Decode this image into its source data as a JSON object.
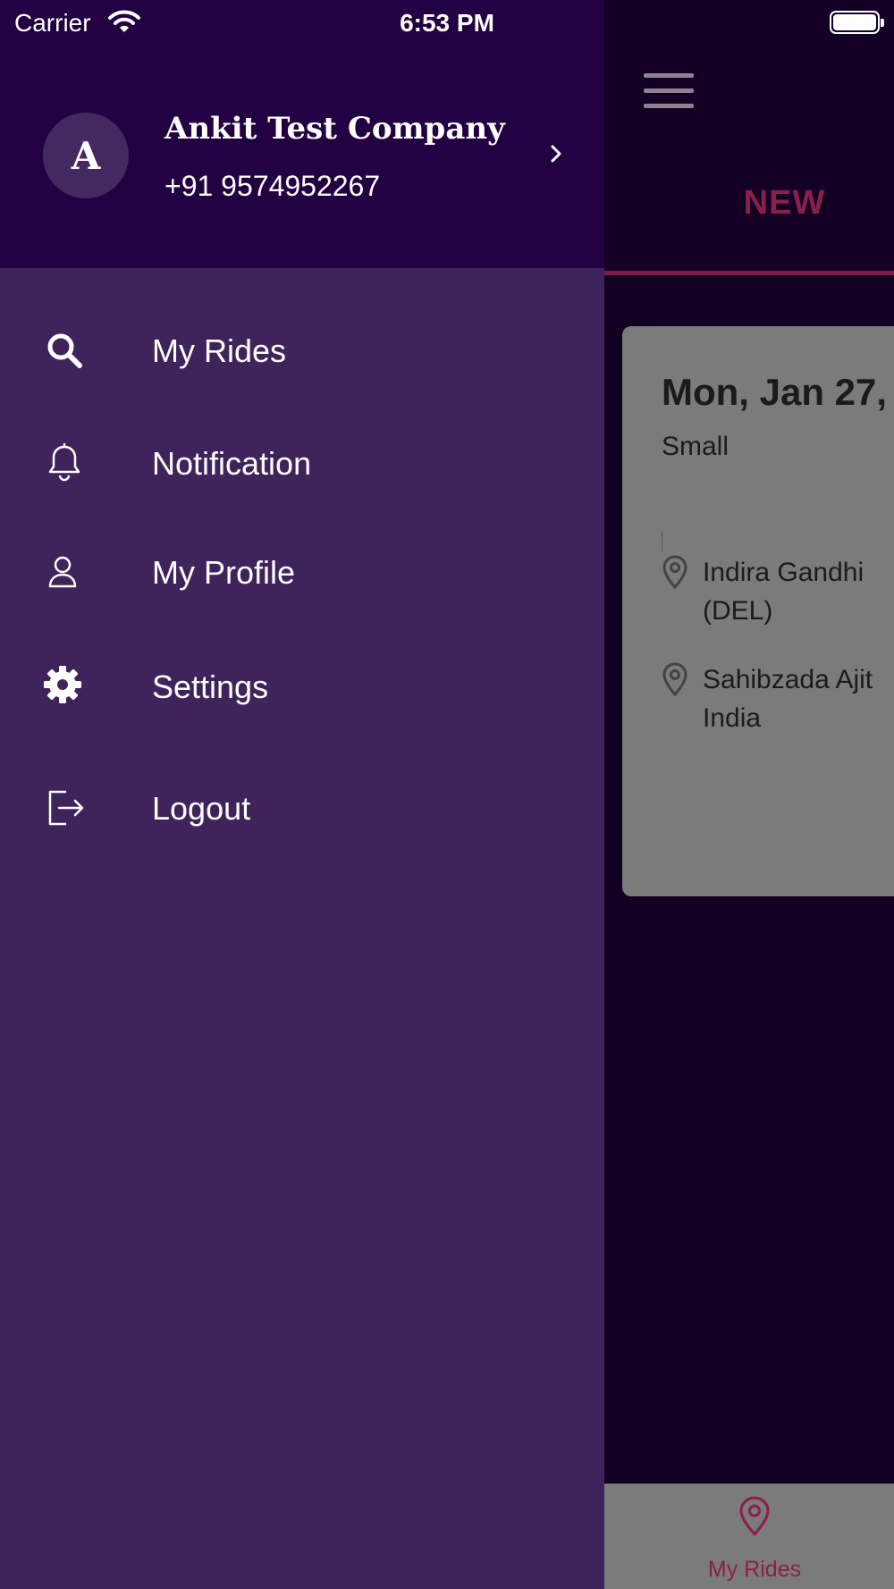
{
  "status_bar": {
    "carrier": "Carrier",
    "time": "6:53 PM"
  },
  "drawer": {
    "user": {
      "avatar_letter": "A",
      "name": "Ankit Test Company",
      "phone": "+91 9574952267"
    },
    "menu": [
      {
        "label": "My Rides",
        "icon": "search-icon"
      },
      {
        "label": "Notification",
        "icon": "bell-icon"
      },
      {
        "label": "My Profile",
        "icon": "user-icon"
      },
      {
        "label": "Settings",
        "icon": "gear-icon"
      },
      {
        "label": "Logout",
        "icon": "logout-icon"
      }
    ]
  },
  "background": {
    "tab_label": "NEW",
    "card": {
      "date": "Mon, Jan 27,",
      "size": "Small",
      "pickup_line1": "Indira Gandhi",
      "pickup_line2": "(DEL)",
      "drop_line1": "Sahibzada Ajit",
      "drop_line2": "India"
    },
    "bottom_tab_label": "My Rides"
  },
  "colors": {
    "drawer_bg": "#3f245c",
    "drawer_header_bg": "#230041",
    "accent": "#8a1f4c"
  }
}
